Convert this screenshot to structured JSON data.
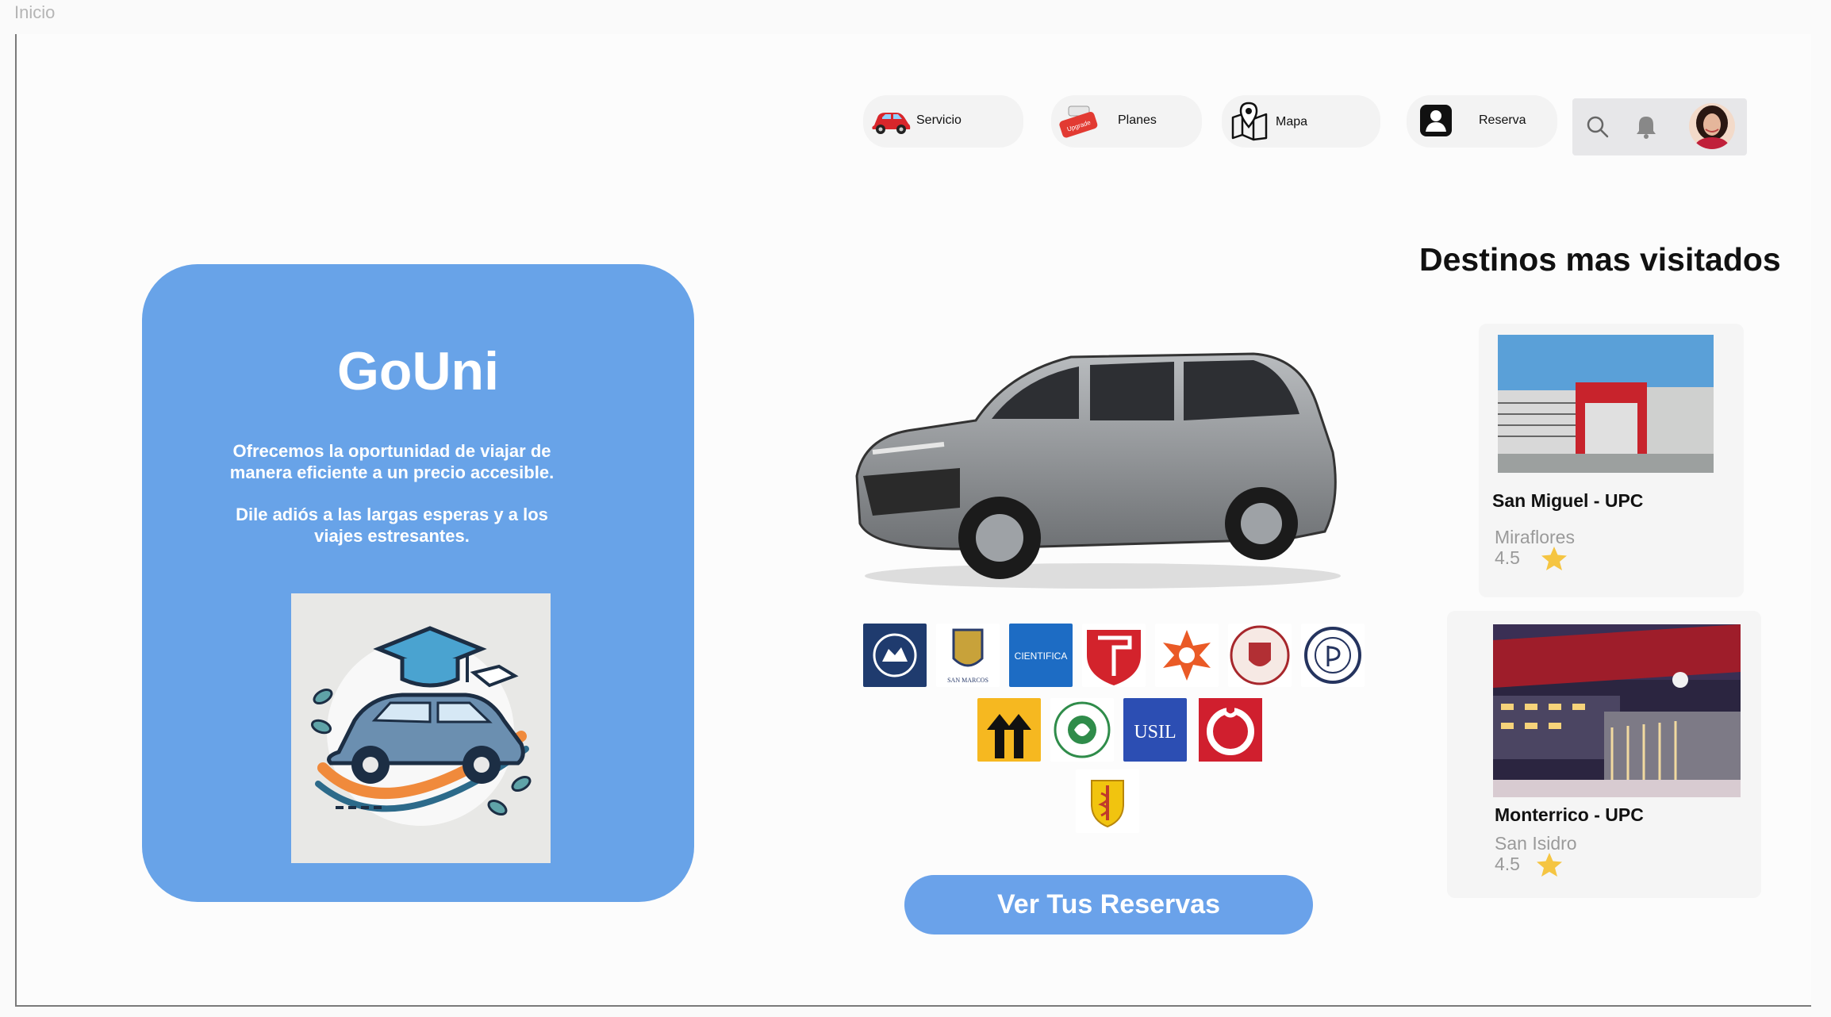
{
  "page": {
    "label": "Inicio"
  },
  "nav": {
    "items": [
      {
        "label": "Servicio",
        "icon": "car-icon"
      },
      {
        "label": "Planes",
        "icon": "upgrade-icon"
      },
      {
        "label": "Mapa",
        "icon": "map-icon"
      },
      {
        "label": "Reserva",
        "icon": "profile-icon"
      }
    ],
    "upgrade_badge": "Upgrade"
  },
  "hero": {
    "title": "GoUni",
    "paragraph1": "Ofrecemos la oportunidad de viajar de manera eficiente a un precio accesible.",
    "paragraph2": "Dile adiós a las largas esperas y a los viajes estresantes."
  },
  "universities": {
    "logo_texts": [
      "SAN MARCOS",
      "CIENTIFICA",
      "USIL"
    ]
  },
  "cta": {
    "label": "Ver Tus Reservas"
  },
  "destinations": {
    "title": "Destinos mas visitados",
    "items": [
      {
        "name": "San Miguel - UPC",
        "district": "Miraflores",
        "rating": "4.5"
      },
      {
        "name": "Monterrico  - UPC",
        "district": "San Isidro",
        "rating": "4.5"
      }
    ]
  },
  "colors": {
    "accent": "#68a3e8",
    "star": "#f5c542",
    "upc_red": "#d01f2e"
  }
}
